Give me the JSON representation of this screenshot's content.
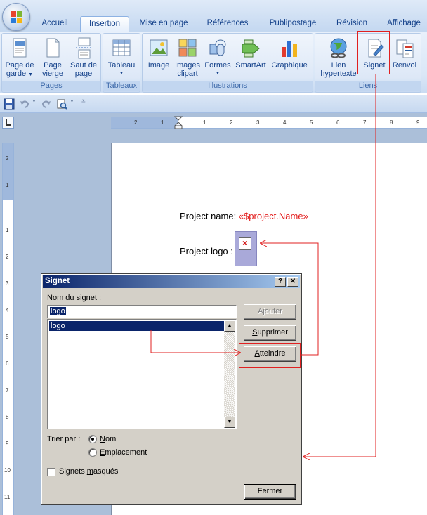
{
  "tabs": [
    {
      "label": "Accueil"
    },
    {
      "label": "Insertion"
    },
    {
      "label": "Mise en page"
    },
    {
      "label": "Références"
    },
    {
      "label": "Publipostage"
    },
    {
      "label": "Révision"
    },
    {
      "label": "Affichage"
    }
  ],
  "ribbon": {
    "pages": {
      "label": "Pages",
      "page_de_garde_1": "Page de",
      "page_de_garde_2": "garde",
      "page_vierge_1": "Page",
      "page_vierge_2": "vierge",
      "saut_1": "Saut de",
      "saut_2": "page"
    },
    "tableaux": {
      "label": "Tableaux",
      "tableau": "Tableau"
    },
    "illustrations": {
      "label": "Illustrations",
      "image": "Image",
      "clipart_1": "Images",
      "clipart_2": "clipart",
      "formes": "Formes",
      "smartart": "SmartArt",
      "graphique": "Graphique"
    },
    "liens": {
      "label": "Liens",
      "lien_1": "Lien",
      "lien_2": "hypertexte",
      "signet": "Signet",
      "renvoi": "Renvoi"
    }
  },
  "document": {
    "project_name_label": "Project name:",
    "project_name_field": "«$project.Name»",
    "project_logo_label": "Project logo :"
  },
  "ruler": {
    "h_left": [
      "1",
      "2"
    ],
    "h_right": [
      "1",
      "2",
      "3",
      "4",
      "5",
      "6",
      "7",
      "8",
      "9"
    ],
    "v_top": [
      "2",
      "1"
    ],
    "v_bottom": [
      "1",
      "2",
      "3",
      "4",
      "5",
      "6",
      "7",
      "8",
      "9",
      "10",
      "11"
    ]
  },
  "dialog": {
    "title": "Signet",
    "help_btn": "?",
    "close_btn": "✕",
    "name_label_pre": "",
    "name_label_u": "N",
    "name_label_post": "om du signet :",
    "name_value": "logo",
    "list_items": [
      "logo"
    ],
    "ajouter": "Ajouter",
    "supprimer_u": "S",
    "supprimer_rest": "upprimer",
    "atteindre_u": "A",
    "atteindre_rest": "tteindre",
    "trier_label": "Trier par :",
    "radio_nom_u": "N",
    "radio_nom_rest": "om",
    "radio_emplacement_u": "E",
    "radio_emplacement_rest": "mplacement",
    "signets_masques_pre": "Signets ",
    "signets_masques_u": "m",
    "signets_masques_post": "asqués",
    "fermer": "Fermer",
    "sort_by": "Nom",
    "hidden_checked": false
  },
  "colors": {
    "annotation": "#e02020",
    "mergefield": "#e31b1b",
    "dialog_title": "#0a246a"
  }
}
